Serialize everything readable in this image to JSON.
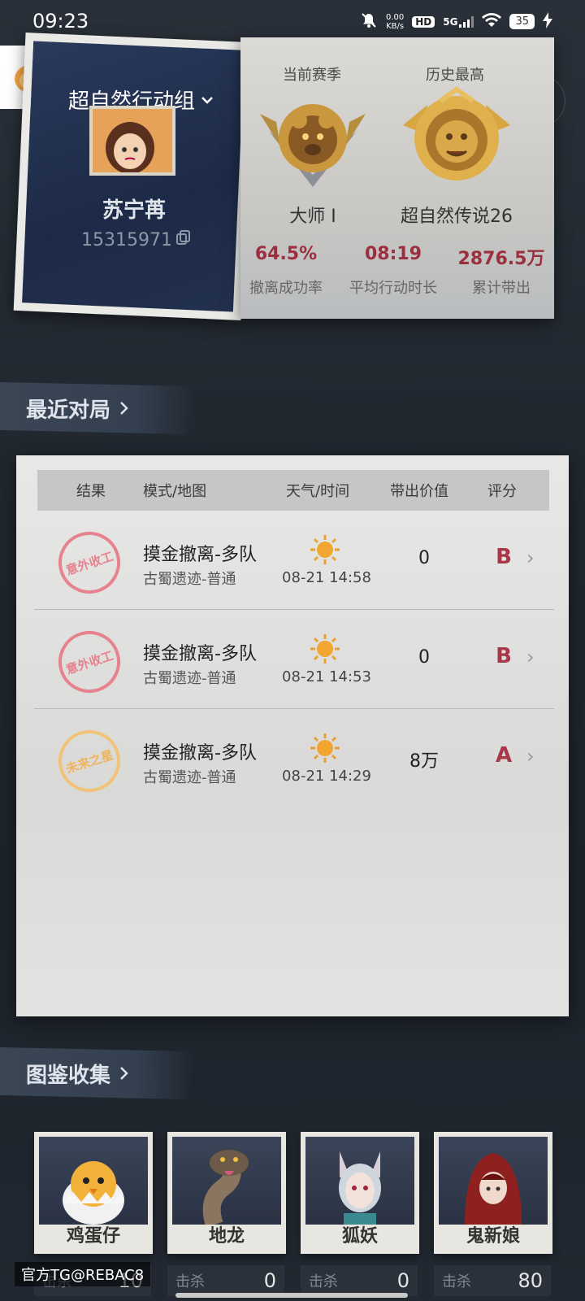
{
  "status_bar": {
    "time": "09:23",
    "net_speed_value": "0.00",
    "net_speed_unit": "KB/s",
    "hd": "HD",
    "signal": "5G",
    "battery": "35"
  },
  "profile": {
    "team_name": "超自然行动组",
    "player_name": "苏宁苒",
    "player_id": "15315971"
  },
  "stats": {
    "current_season_label": "当前赛季",
    "best_label": "历史最高",
    "current_rank": "大师 Ⅰ",
    "best_rank": "超自然传说26",
    "items": [
      {
        "value": "64.5%",
        "label": "撤离成功率"
      },
      {
        "value": "08:19",
        "label": "平均行动时长"
      },
      {
        "value": "2876.5万",
        "label": "累计带出"
      }
    ]
  },
  "recent": {
    "title": "最近对局",
    "headers": {
      "result": "结果",
      "mode_map": "模式/地图",
      "weather_time": "天气/时间",
      "value": "带出价值",
      "grade": "评分"
    },
    "matches": [
      {
        "stamp": "意外收工",
        "mode": "摸金撤离-多队",
        "map": "古蜀遗迹-普通",
        "time": "08-21 14:58",
        "value": "0",
        "grade": "B"
      },
      {
        "stamp": "意外收工",
        "mode": "摸金撤离-多队",
        "map": "古蜀遗迹-普通",
        "time": "08-21 14:53",
        "value": "0",
        "grade": "B"
      },
      {
        "stamp": "未来之星",
        "mode": "摸金撤离-多队",
        "map": "古蜀遗迹-普通",
        "time": "08-21 14:29",
        "value": "8万",
        "grade": "A"
      }
    ]
  },
  "collection": {
    "title": "图鉴收集",
    "kill_label": "击杀",
    "items": [
      {
        "name": "鸡蛋仔",
        "kills": "10"
      },
      {
        "name": "地龙",
        "kills": "0"
      },
      {
        "name": "狐妖",
        "kills": "0"
      },
      {
        "name": "鬼新娘",
        "kills": "80"
      }
    ]
  },
  "watermark": "官方TG@REBAC8",
  "colors": {
    "accent_red": "#9b2f3d",
    "grade_red": "#a8374a",
    "stamp_red": "#e7838e",
    "stamp_gold": "#f0b45c"
  }
}
